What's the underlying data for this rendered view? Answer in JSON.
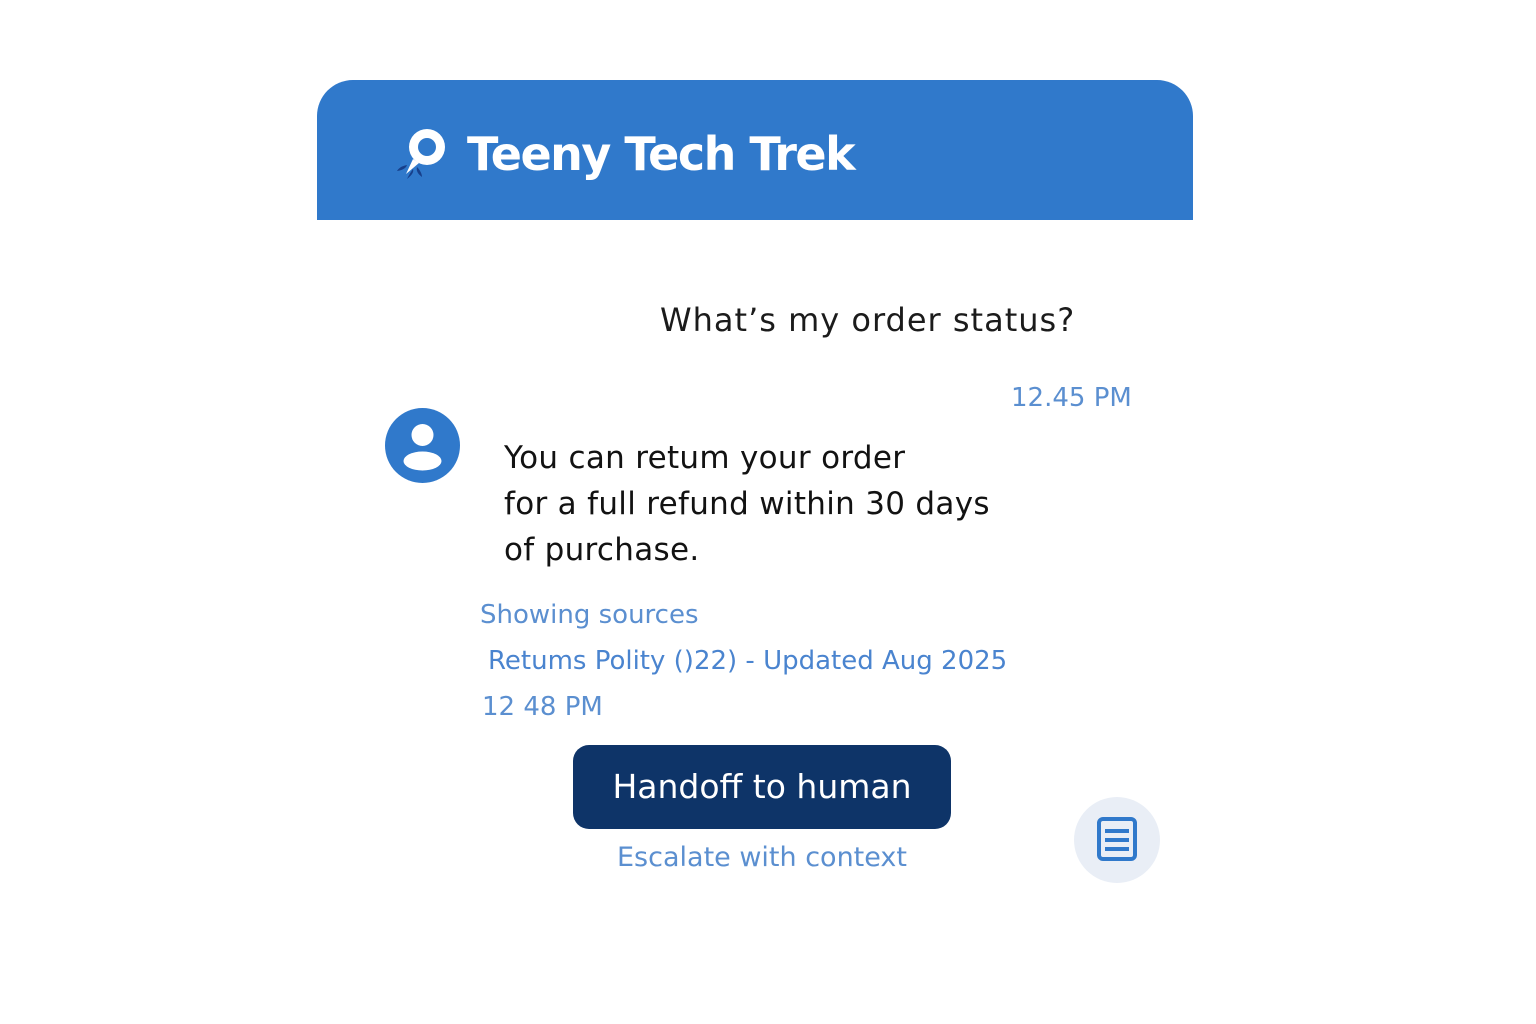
{
  "header": {
    "title": "Teeny Tech Trek",
    "logo_icon": "chat-bubble-leaf-logo-icon",
    "background_color": "#3079cb"
  },
  "conversation": {
    "user_message": {
      "text": "What’s my order status?",
      "time": "12.45 PM"
    },
    "bot_message": {
      "avatar_icon": "user-avatar-icon",
      "lines": [
        "You can retum your order",
        "for a full refund within 30 days",
        "of purchase."
      ],
      "sources_label": "Showing sources",
      "source": "Retums Polity ()22)  - Updated Aug 2025",
      "time": "12 48 PM"
    }
  },
  "actions": {
    "handoff_label": "Handoff to human",
    "handoff_color": "#0e3468",
    "escalate_label": "Escalate with context",
    "document_icon": "document-icon"
  }
}
